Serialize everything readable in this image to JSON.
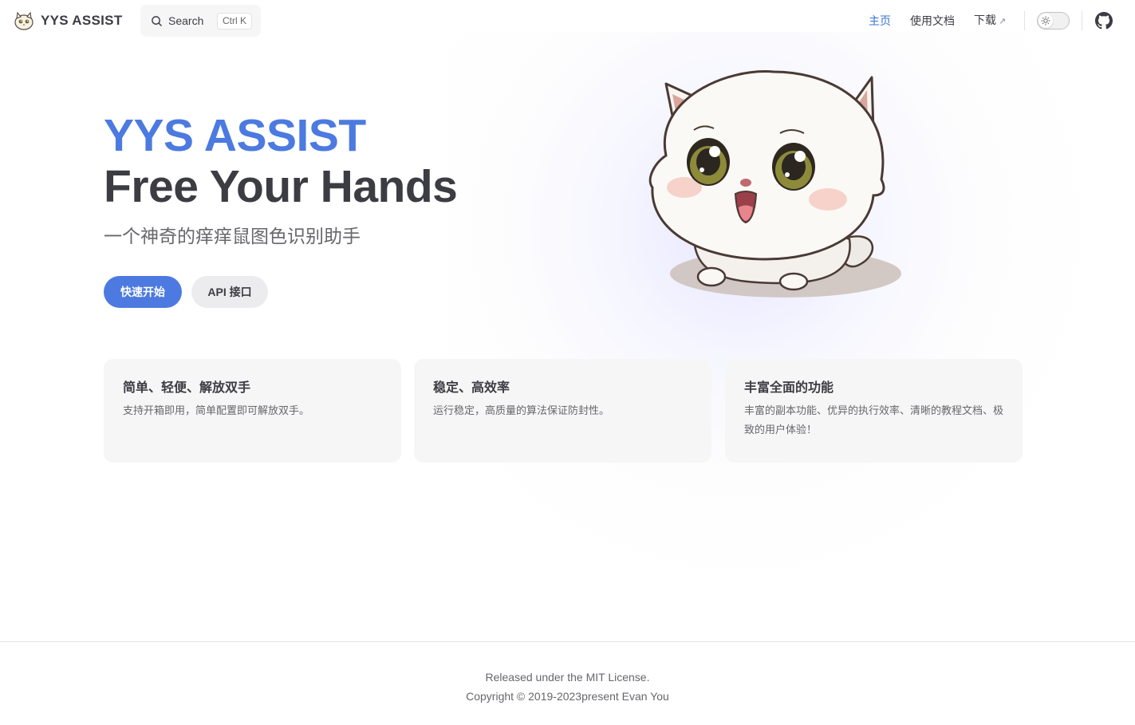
{
  "brand": {
    "title": "YYS ASSIST"
  },
  "search": {
    "label": "Search",
    "shortcut": "Ctrl K"
  },
  "nav": {
    "links": [
      {
        "label": "主页",
        "active": true
      },
      {
        "label": "使用文档",
        "active": false
      },
      {
        "label": "下载",
        "active": false,
        "external_mark": "↗"
      }
    ]
  },
  "hero": {
    "name": "YYS ASSIST",
    "text": "Free Your Hands",
    "tagline": "一个神奇的痒痒鼠图色识别助手",
    "actions": [
      {
        "label": "快速开始",
        "theme": "brand"
      },
      {
        "label": "API 接口",
        "theme": "alt"
      }
    ]
  },
  "features": [
    {
      "title": "简单、轻便、解放双手",
      "details": "支持开箱即用，简单配置即可解放双手。"
    },
    {
      "title": "稳定、高效率",
      "details": "运行稳定，高质量的算法保证防封性。"
    },
    {
      "title": "丰富全面的功能",
      "details": "丰富的副本功能、优异的执行效率、清晰的教程文档、极致的用户体验！"
    }
  ],
  "footer": {
    "message": "Released under the MIT License.",
    "copyright": "Copyright © 2019-2023present Evan You"
  },
  "colors": {
    "brand": "#4c7ae0",
    "text": "#3c3c43",
    "muted": "#67676c",
    "card_bg": "#f6f6f7"
  },
  "icons": [
    "cat-logo-icon",
    "search-icon",
    "external-link-icon",
    "sun-icon",
    "github-icon",
    "cat-mascot-image"
  ]
}
